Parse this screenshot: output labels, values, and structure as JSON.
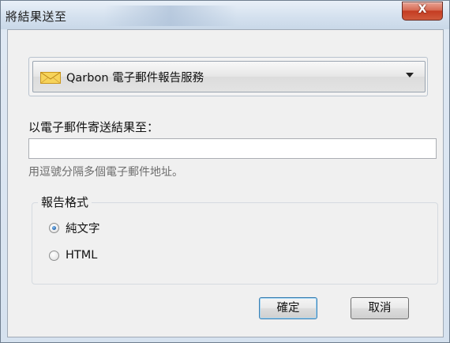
{
  "window": {
    "title": "將結果送至",
    "close_label": "X"
  },
  "report_service": {
    "selected": "Qarbon 電子郵件報告服務"
  },
  "email": {
    "label": "以電子郵件寄送結果至：",
    "value": "",
    "placeholder": "",
    "hint": "用逗號分隔多個電子郵件地址。"
  },
  "report_format": {
    "legend": "報告格式",
    "options": [
      {
        "label": "純文字",
        "checked": true
      },
      {
        "label": "HTML",
        "checked": false
      }
    ]
  },
  "buttons": {
    "ok_label": "確定",
    "cancel_label": "取消"
  },
  "colors": {
    "accent": "#3c7fb1",
    "close": "#c43c22",
    "envelope": "#f0c23a"
  }
}
